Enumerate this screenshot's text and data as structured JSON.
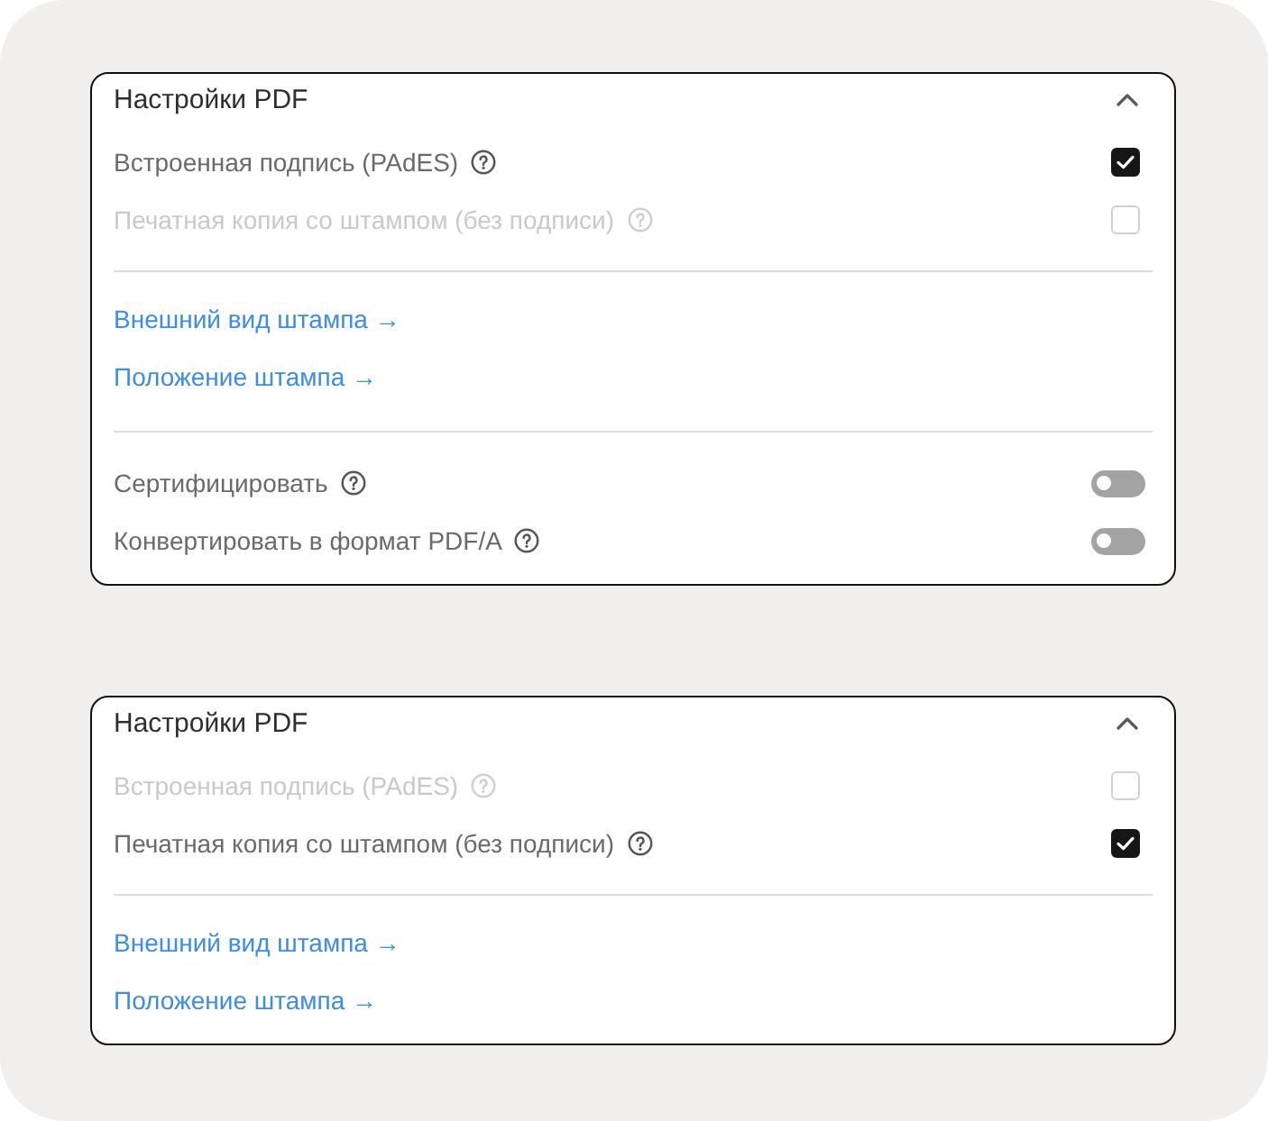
{
  "panels": [
    {
      "title": "Настройки PDF",
      "expanded": true,
      "options": [
        {
          "label": "Встроенная подпись (PAdES)",
          "disabled": false,
          "checked": true
        },
        {
          "label": "Печатная копия со штампом (без подписи)",
          "disabled": true,
          "checked": false
        }
      ],
      "links": [
        "Внешний вид штампа →",
        "Положение штампа →"
      ],
      "toggles": [
        {
          "label": "Сертифицировать",
          "on": false
        },
        {
          "label": "Конвертировать в формат PDF/A",
          "on": false
        }
      ]
    },
    {
      "title": "Настройки PDF",
      "expanded": true,
      "options": [
        {
          "label": "Встроенная подпись (PAdES)",
          "disabled": true,
          "checked": false
        },
        {
          "label": "Печатная копия со штампом (без подписи)",
          "disabled": false,
          "checked": true
        }
      ],
      "links": [
        "Внешний вид штампа →",
        "Положение штампа →"
      ]
    }
  ]
}
